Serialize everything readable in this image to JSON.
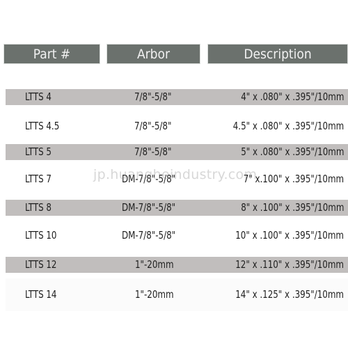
{
  "table": {
    "headers": {
      "part": "Part #",
      "arbor": "Arbor",
      "description": "Description"
    },
    "rows": [
      {
        "part": "LTTS 4",
        "arbor": "7/8\"-5/8\"",
        "description": "4\" x .080\" x .395\"/10mm",
        "shaded": true
      },
      {
        "part": "LTTS 4.5",
        "arbor": "7/8\"-5/8\"",
        "description": "4.5\" x .080\" x .395\"/10mm",
        "shaded": false
      },
      {
        "part": "LTTS 5",
        "arbor": "7/8\"-5/8\"",
        "description": "5\" x .080\" x .395\"/10mm",
        "shaded": true
      },
      {
        "part": "LTTS 7",
        "arbor": "DM-7/8\"-5/8\"",
        "description": "7\" x.100\"  x .395\"/10mm",
        "shaded": false
      },
      {
        "part": "LTTS 8",
        "arbor": "DM-7/8\"-5/8\"",
        "description": "8\" x .100\" x .395\"/10mm",
        "shaded": true
      },
      {
        "part": "LTTS 10",
        "arbor": "DM-7/8\"-5/8\"",
        "description": "10\" x .100\"  x .395\"/10mm",
        "shaded": false
      },
      {
        "part": "LTTS 12",
        "arbor": "1\"-20mm",
        "description": "12\" x .110\"  x .395\"/10mm",
        "shaded": true
      },
      {
        "part": "LTTS 14",
        "arbor": "1\"-20mm",
        "description": "14\" x .125\"  x .395\"/10mm",
        "shaded": false
      }
    ]
  },
  "watermark": "jp.huangheindustry.com",
  "colors": {
    "header_bg": "#6b716d",
    "header_text": "#f2f2f2",
    "row_shade": "#c1bebd",
    "text": "#1e1e1e"
  }
}
